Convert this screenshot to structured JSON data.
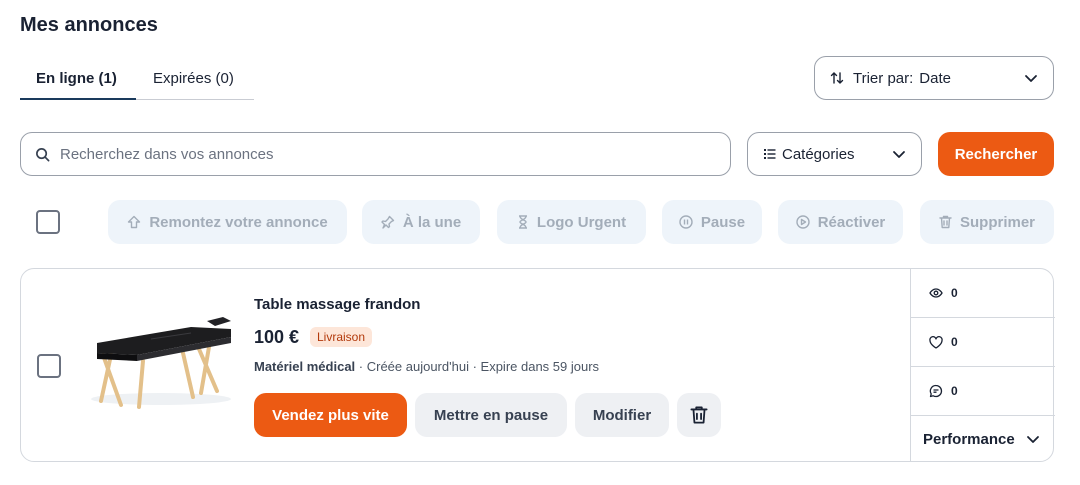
{
  "page_title": "Mes annonces",
  "tabs": [
    {
      "label": "En ligne (1)",
      "active": true
    },
    {
      "label": "Expirées (0)",
      "active": false
    }
  ],
  "sort": {
    "label": "Trier par:",
    "value": "Date",
    "icon": "sort-arrows-icon"
  },
  "search": {
    "placeholder": "Recherchez dans vos annonces",
    "value": "",
    "button_label": "Rechercher",
    "icon": "search-icon"
  },
  "categories": {
    "label": "Catégories",
    "icon": "list-icon"
  },
  "bulk_actions": [
    {
      "label": "Remontez votre annonce",
      "icon": "arrow-up-icon",
      "enabled": false
    },
    {
      "label": "À la une",
      "icon": "pin-icon",
      "enabled": false
    },
    {
      "label": "Logo Urgent",
      "icon": "hourglass-icon",
      "enabled": false
    },
    {
      "label": "Pause",
      "icon": "pause-icon",
      "enabled": false
    },
    {
      "label": "Réactiver",
      "icon": "play-icon",
      "enabled": false
    },
    {
      "label": "Supprimer",
      "icon": "trash-icon",
      "enabled": false
    }
  ],
  "listing": {
    "title": "Table massage frandon",
    "price": "100 €",
    "badge": "Livraison",
    "category": "Matériel médical",
    "created": "Créée aujourd'hui",
    "expires": "Expire dans 59 jours",
    "buttons": {
      "sell_faster": "Vendez plus vite",
      "pause": "Mettre en pause",
      "edit": "Modifier"
    },
    "stats": {
      "views": "0",
      "favorites": "0",
      "messages": "0"
    },
    "performance_label": "Performance"
  },
  "colors": {
    "accent": "#ec5a13",
    "tab_indicator": "#1a3a5c",
    "disabled_bg": "#eef4fa",
    "disabled_text": "#a3adb9"
  }
}
